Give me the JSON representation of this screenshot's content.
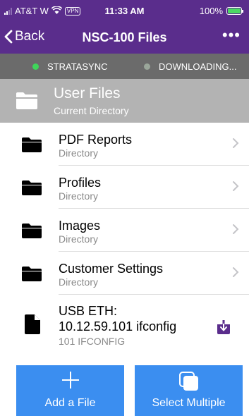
{
  "status_bar": {
    "carrier": "AT&T W",
    "vpn": "VPN",
    "time": "11:33 AM",
    "battery": "100%",
    "battery_level": 1.0
  },
  "nav": {
    "back_label": "Back",
    "title": "NSC-100 Files",
    "more_label": "•••"
  },
  "sync": {
    "items": [
      {
        "label": "STRATASYNC",
        "color": "#3fd65a"
      },
      {
        "label": "DOWNLOADING...",
        "color": "#9aa69a"
      }
    ]
  },
  "current_dir": {
    "title": "User Files",
    "subtitle": "Current Directory"
  },
  "directories": [
    {
      "name": "PDF Reports",
      "kind": "Directory"
    },
    {
      "name": "Profiles",
      "kind": "Directory"
    },
    {
      "name": "Images",
      "kind": "Directory"
    },
    {
      "name": "Customer Settings",
      "kind": "Directory"
    }
  ],
  "file": {
    "line1": "USB ETH:",
    "line2": "10.12.59.101 ifconfig",
    "kind": "101 IFCONFIG"
  },
  "actions": {
    "add_label": "Add a File",
    "multi_label": "Select Multiple"
  },
  "colors": {
    "header": "#5a2d8c",
    "syncbar": "#6b6b6b",
    "current_dir": "#b3b3b3",
    "button": "#3b8ef0",
    "download_icon": "#5a2d8c"
  }
}
